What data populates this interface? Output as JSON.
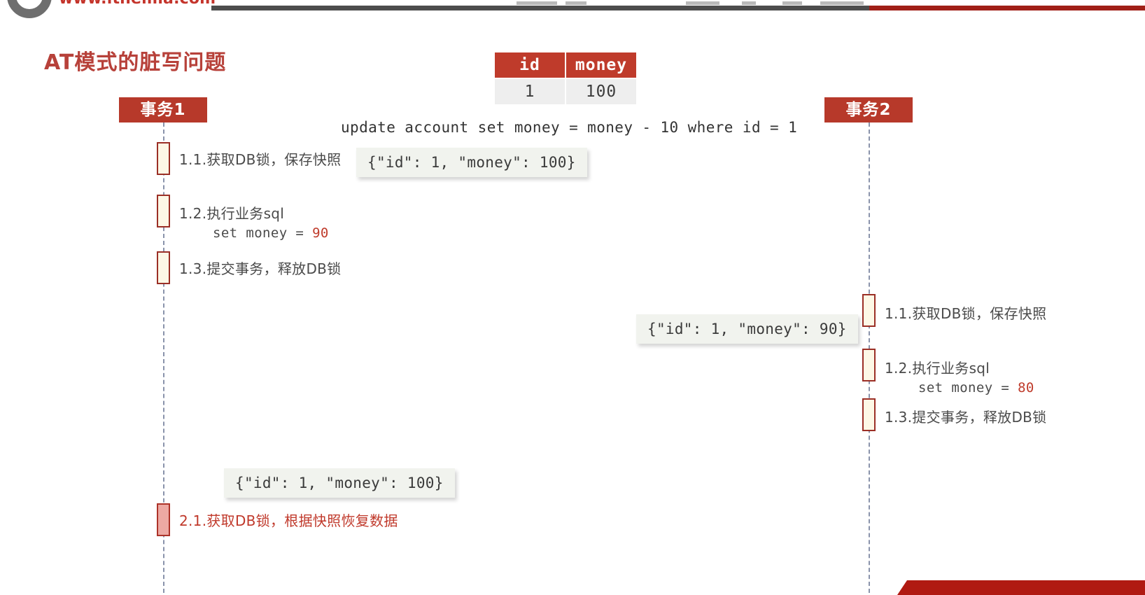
{
  "header": {
    "logo_icon": "itheima-ring-logo",
    "url_text": "www.itheima.com"
  },
  "title": "AT模式的脏写问题",
  "account_table": {
    "columns": [
      "id",
      "money"
    ],
    "rows": [
      [
        "1",
        "100"
      ]
    ]
  },
  "sql_statement": "update account set money = money - 10 where id = 1",
  "transactions": [
    {
      "actor_label": "事务1",
      "steps": [
        {
          "label": "1.1.获取DB锁，保存快照",
          "sub": null,
          "state": "normal"
        },
        {
          "label": "1.2.执行业务sql",
          "sub_prefix": "set money = ",
          "sub_value": "90",
          "state": "normal"
        },
        {
          "label": "1.3.提交事务，释放DB锁",
          "sub": null,
          "state": "normal"
        },
        {
          "label": "2.1.获取DB锁，根据快照恢复数据",
          "sub": null,
          "state": "rollback"
        }
      ]
    },
    {
      "actor_label": "事务2",
      "steps": [
        {
          "label": "1.1.获取DB锁，保存快照",
          "sub": null,
          "state": "normal"
        },
        {
          "label": "1.2.执行业务sql",
          "sub_prefix": "set money = ",
          "sub_value": "80",
          "state": "normal"
        },
        {
          "label": "1.3.提交事务，释放DB锁",
          "sub": null,
          "state": "normal"
        }
      ]
    }
  ],
  "callouts": [
    {
      "id": "snapshot-tx1",
      "text": "{\"id\": 1, \"money\": 100}"
    },
    {
      "id": "snapshot-tx2",
      "text": "{\"id\": 1, \"money\": 90}"
    },
    {
      "id": "restore-tx1",
      "text": "{\"id\": 1, \"money\": 100}"
    }
  ],
  "colors": {
    "brand_red": "#bf3b2b",
    "title_red": "#b7413a",
    "actor_red": "#b7392a",
    "activation_fill": "#fdf8e6",
    "activation_border": "#9b2f26",
    "rollback_fill": "#eda9a3",
    "lifeline": "#8a93ab",
    "callout_bg": "#f1f3ee",
    "banner_red": "#b01a12"
  }
}
